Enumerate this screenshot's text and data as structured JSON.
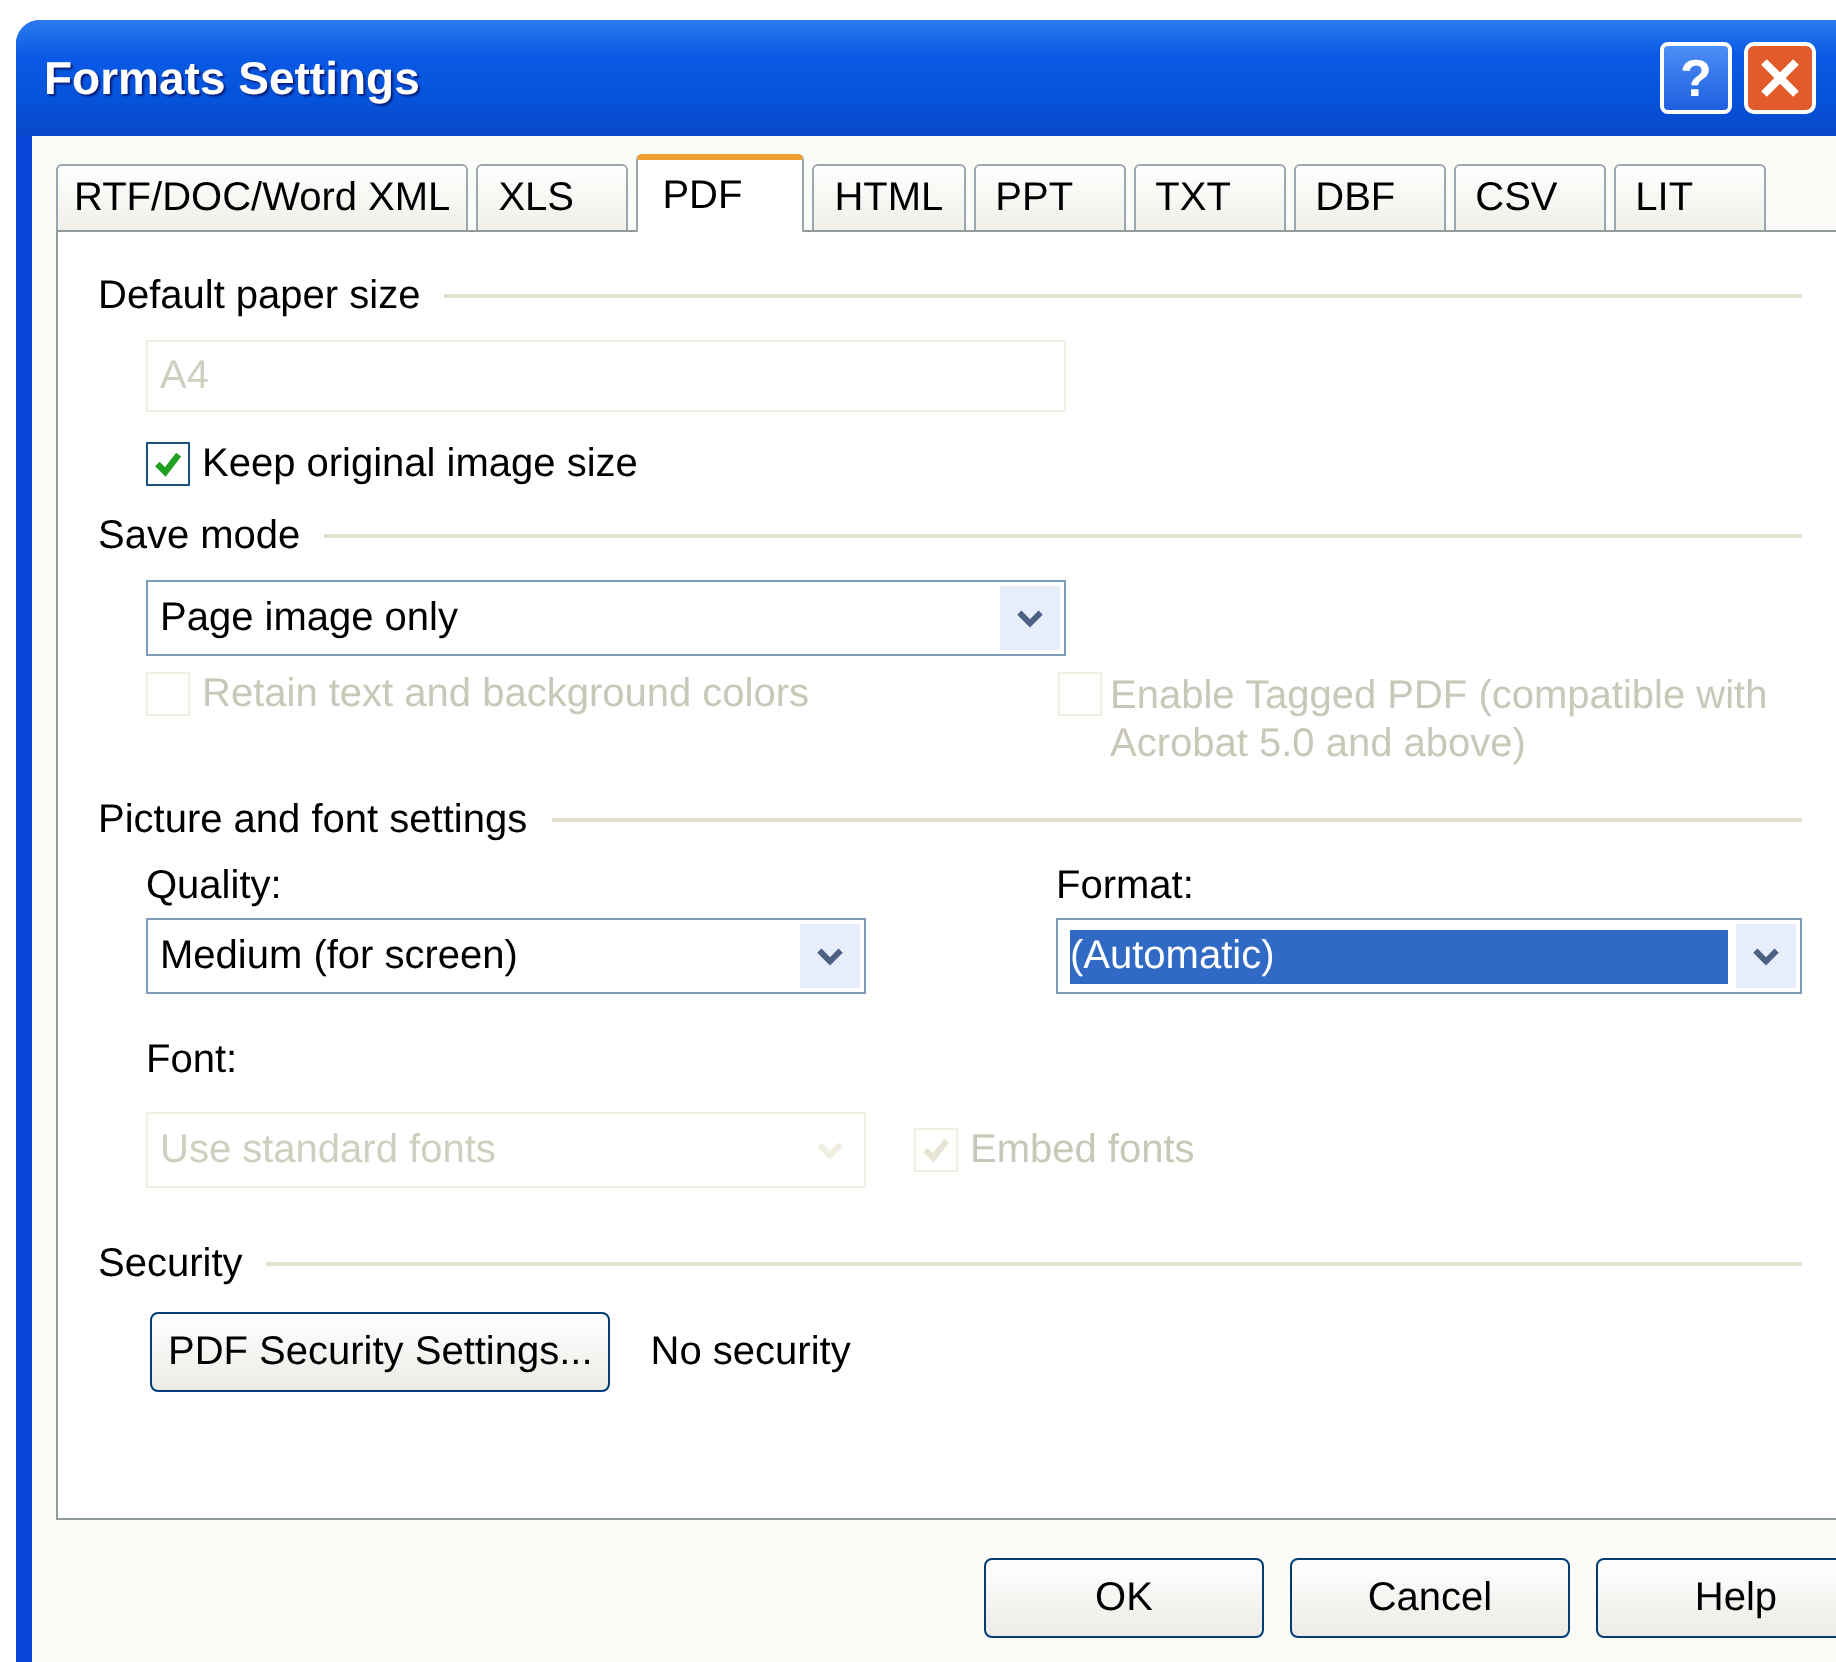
{
  "window": {
    "title": "Formats Settings",
    "help_button": "?"
  },
  "tabs": [
    {
      "label": "RTF/DOC/Word XML",
      "selected": false
    },
    {
      "label": "XLS",
      "selected": false
    },
    {
      "label": "PDF",
      "selected": true
    },
    {
      "label": "HTML",
      "selected": false
    },
    {
      "label": "PPT",
      "selected": false
    },
    {
      "label": "TXT",
      "selected": false
    },
    {
      "label": "DBF",
      "selected": false
    },
    {
      "label": "CSV",
      "selected": false
    },
    {
      "label": "LIT",
      "selected": false
    }
  ],
  "paper_size": {
    "heading": "Default paper size",
    "field": {
      "value": "A4",
      "disabled": true
    },
    "keep_original": {
      "label": "Keep original image size",
      "checked": true,
      "disabled": false
    }
  },
  "save_mode": {
    "heading": "Save mode",
    "dropdown": {
      "value": "Page image only",
      "disabled": false
    },
    "retain_colors": {
      "label": "Retain text and background colors",
      "checked": false,
      "disabled": true
    },
    "tagged_pdf": {
      "label": "Enable Tagged PDF (compatible with Acrobat 5.0 and above)",
      "checked": false,
      "disabled": true
    }
  },
  "picture_font": {
    "heading": "Picture and font settings",
    "quality": {
      "label": "Quality:",
      "value": "Medium (for screen)",
      "disabled": false,
      "focused": false
    },
    "format": {
      "label": "Format:",
      "value": "(Automatic)",
      "disabled": false,
      "focused": true
    },
    "font": {
      "label": "Font:",
      "value": "Use standard fonts",
      "disabled": true,
      "focused": false
    },
    "embed_fonts": {
      "label": "Embed fonts",
      "checked": true,
      "disabled": true
    }
  },
  "security": {
    "heading": "Security",
    "button": "PDF Security Settings...",
    "status": "No security"
  },
  "buttons": [
    "OK",
    "Cancel",
    "Help"
  ]
}
